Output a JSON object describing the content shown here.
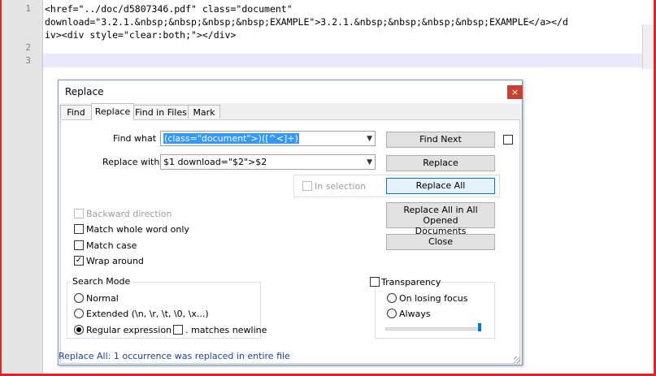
{
  "editor": {
    "line_numbers": [
      "1",
      "2",
      "3"
    ],
    "line1": [
      "<href=\"../doc/d5807346.pdf\" class=\"document\"",
      "download=\"3.2.1.&nbsp;&nbsp;&nbsp;&nbsp;EXAMPLE\">3.2.1.&nbsp;&nbsp;&nbsp;&nbsp;EXAMPLE</a></d",
      "iv><div style=\"clear:both;\"></div>"
    ]
  },
  "dialog": {
    "title": "Replace",
    "close_glyph": "×",
    "tabs": [
      "Find",
      "Replace",
      "Find in Files",
      "Mark"
    ],
    "find_label": "Find what :",
    "find_value": "(class=\"document\">)([^<]+)",
    "replace_label": "Replace with :",
    "replace_value": "$1 download=\"$2\">$2",
    "in_selection_label": "In selection",
    "buttons": {
      "find_next": "Find Next",
      "replace": "Replace",
      "replace_all": "Replace All",
      "replace_all_opened_1": "Replace All in All Opened",
      "replace_all_opened_2": "Documents",
      "close": "Close"
    },
    "options": {
      "backward": "Backward direction",
      "whole_word": "Match whole word only",
      "match_case": "Match case",
      "wrap_around": "Wrap around",
      "wrap_check": "✓"
    },
    "search_mode": {
      "title": "Search Mode",
      "normal": "Normal",
      "extended": "Extended (\\n, \\r, \\t, \\0, \\x...)",
      "regex": "Regular expression",
      "matches_newline": ". matches newline"
    },
    "transparency": {
      "title": "Transparency",
      "on_losing_focus": "On losing focus",
      "always": "Always",
      "level": 1.0
    },
    "status": "Replace All: 1 occurrence was replaced in entire file"
  }
}
